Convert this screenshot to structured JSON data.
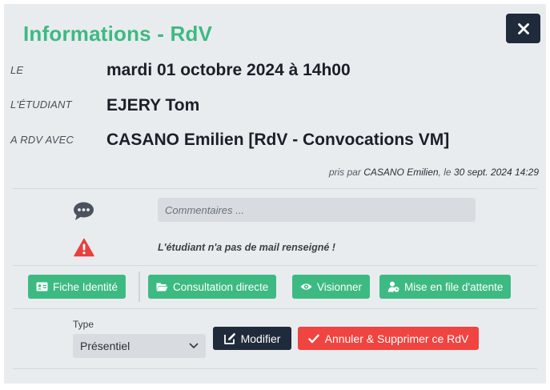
{
  "modal": {
    "title": "Informations - RdV",
    "close_icon": "close-icon"
  },
  "details": {
    "date_label": "LE",
    "date_value": "mardi 01 octobre 2024 à 14h00",
    "student_label": "L'ÉTUDIANT",
    "student_value": "EJERY Tom",
    "with_label": "A RDV AVEC",
    "with_value": "CASANO Emilien [RdV - Convocations VM]"
  },
  "meta": {
    "prefix": "pris par",
    "author": "CASANO Emilien",
    "mid": ", le",
    "datetime": "30 sept. 2024 14:29"
  },
  "comment": {
    "icon": "comment-icon",
    "placeholder": "Commentaires ..."
  },
  "warning": {
    "icon": "warning-icon",
    "color": "#e8413c",
    "text": "L'étudiant n'a pas de mail renseigné !"
  },
  "actions": {
    "fiche_identite": "Fiche Identité",
    "consultation_directe": "Consultation directe",
    "visionner": "Visionner",
    "mise_en_file": "Mise en file d'attente"
  },
  "form": {
    "type_label": "Type",
    "type_selected": "Présentiel",
    "modifier_label": "Modifier",
    "annuler_label": "Annuler & Supprimer ce RdV"
  },
  "colors": {
    "accent_green": "#3dba82",
    "dark": "#1f2a3a",
    "danger": "#f04440"
  }
}
